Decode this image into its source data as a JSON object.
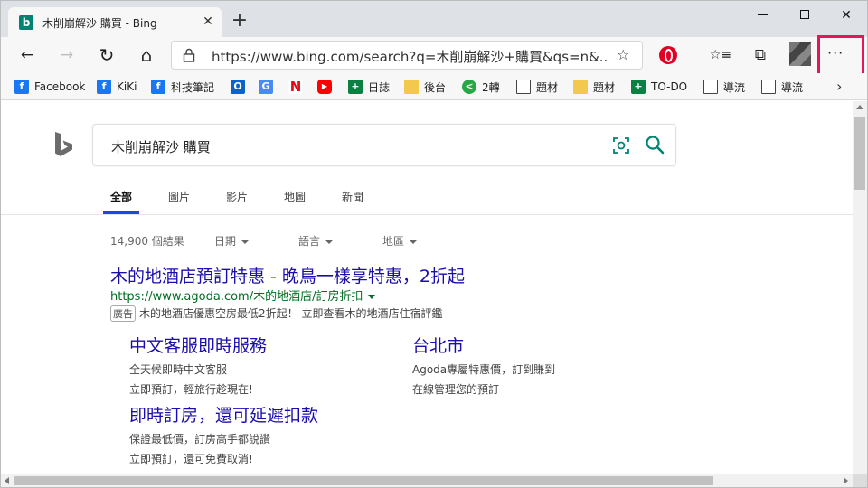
{
  "window": {
    "tab_title": "木削崩解沙 購買 - Bing",
    "new_tab_glyph": "+",
    "close_tab_glyph": "✕",
    "close_window_glyph": "✕"
  },
  "toolbar": {
    "url": "https://www.bing.com/search?q=木削崩解沙+購買&qs=n&...",
    "back_glyph": "←",
    "forward_glyph": "→",
    "refresh_glyph": "↻",
    "home_glyph": "⌂",
    "star_glyph": "☆",
    "favorites_glyph": "☆≡",
    "collections_glyph": "⧉",
    "more_glyph": "···"
  },
  "bookmarks": [
    {
      "label": "Facebook",
      "icon": "facebook-icon",
      "glyph": "f"
    },
    {
      "label": "KiKi",
      "icon": "facebook-icon",
      "glyph": "f"
    },
    {
      "label": "科技筆記",
      "icon": "facebook-icon",
      "glyph": "f"
    },
    {
      "label": "",
      "icon": "outlook-icon",
      "glyph": "O"
    },
    {
      "label": "",
      "icon": "translate-icon",
      "glyph": "G"
    },
    {
      "label": "",
      "icon": "netflix-icon",
      "glyph": "N"
    },
    {
      "label": "",
      "icon": "youtube-icon",
      "glyph": "▶"
    },
    {
      "label": "日誌",
      "icon": "sheets-icon",
      "glyph": "+"
    },
    {
      "label": "後台",
      "icon": "folder-icon",
      "glyph": ""
    },
    {
      "label": "2轉",
      "icon": "share-icon",
      "glyph": "<"
    },
    {
      "label": "題材",
      "icon": "document-icon",
      "glyph": ""
    },
    {
      "label": "題材",
      "icon": "folder-icon",
      "glyph": ""
    },
    {
      "label": "TO-DO",
      "icon": "sheets-icon",
      "glyph": "+"
    },
    {
      "label": "導流",
      "icon": "document-icon",
      "glyph": ""
    },
    {
      "label": "導流",
      "icon": "document-icon",
      "glyph": ""
    }
  ],
  "bookmarks_more_glyph": "›",
  "search": {
    "query": "木削崩解沙 購買"
  },
  "scopes": [
    "全部",
    "圖片",
    "影片",
    "地圖",
    "新聞"
  ],
  "filters": {
    "count": "14,900 個結果",
    "date": "日期",
    "language": "語言",
    "region": "地區"
  },
  "result": {
    "title": "木的地酒店預訂特惠 - 晚鳥一樣享特惠，2折起",
    "url": "https://www.agoda.com/木的地酒店/訂房折扣",
    "ad_label": "廣告",
    "description": "木的地酒店優惠空房最低2折起！ 立即查看木的地酒店住宿評鑑"
  },
  "sitelinks": [
    {
      "title": "中文客服即時服務",
      "lines": [
        "全天候即時中文客服",
        "立即預訂，輕旅行趁現在!"
      ]
    },
    {
      "title": "台北市",
      "lines": [
        "Agoda專屬特惠價，訂到賺到",
        "在線管理您的預訂"
      ]
    },
    {
      "title": "即時訂房，還可延遲扣款",
      "lines": [
        "保證最低價，訂房高手都說讚",
        "立即預訂，還可免費取消!"
      ]
    }
  ],
  "colors": {
    "link": "#1a0dab",
    "url_green": "#006d21",
    "bing_teal": "#008373",
    "highlight_box": "#e8145a",
    "scope_underline": "#174ae4"
  }
}
